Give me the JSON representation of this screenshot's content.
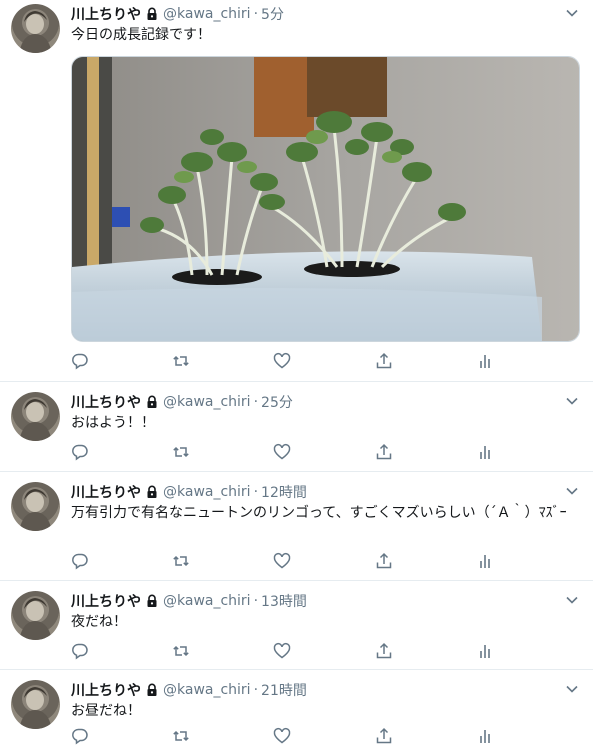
{
  "tweets": [
    {
      "author": "川上ちりや",
      "handle": "@kawa_chiri",
      "separator": "·",
      "time": "5分",
      "text": "今日の成長記録です！",
      "has_media": true,
      "media_description_icon": "plant-photo"
    },
    {
      "author": "川上ちりや",
      "handle": "@kawa_chiri",
      "separator": "·",
      "time": "25分",
      "text": "おはよう！！"
    },
    {
      "author": "川上ちりや",
      "handle": "@kawa_chiri",
      "separator": "·",
      "time": "12時間",
      "text": "万有引力で有名なニュートンのリンゴって、すごくマズいらしい（´Ａ｀）ﾏｽﾞｰ"
    },
    {
      "author": "川上ちりや",
      "handle": "@kawa_chiri",
      "separator": "·",
      "time": "13時間",
      "text": "夜だね！"
    },
    {
      "author": "川上ちりや",
      "handle": "@kawa_chiri",
      "separator": "·",
      "time": "21時間",
      "text": "お昼だね！"
    }
  ],
  "icons": {
    "reply": "reply-icon",
    "retweet": "retweet-icon",
    "like": "like-icon",
    "share": "share-icon",
    "analytics": "analytics-icon",
    "lock": "lock-icon",
    "caret": "chevron-down-icon"
  },
  "colors": {
    "text": "#14171a",
    "muted": "#657786",
    "border": "#e6ecf0"
  }
}
